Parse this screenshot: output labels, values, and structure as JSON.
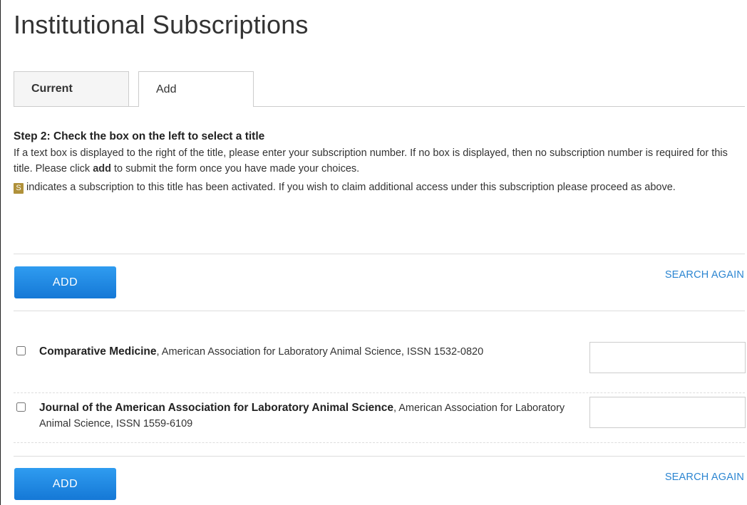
{
  "page": {
    "title": "Institutional Subscriptions"
  },
  "tabs": [
    {
      "label": "Current"
    },
    {
      "label": "Add"
    }
  ],
  "instructions": {
    "heading": "Step 2: Check the box on the left to select a title",
    "line1_a": "If a text box is displayed to the right of the title, please enter your subscription number. If no box is displayed, then no subscription number is required for this title. Please click ",
    "line1_bold": "add",
    "line1_b": " to submit the form once you have made your choices.",
    "badge_letter": "S",
    "line2": "indicates a subscription to this title has been activated. If you wish to claim additional access under this subscription please proceed as above."
  },
  "actions": {
    "add_label": "ADD",
    "search_again_label": "SEARCH AGAIN"
  },
  "titles": [
    {
      "name": "Comparative Medicine",
      "details": ", American Association for Laboratory Animal Science, ISSN 1532-0820",
      "subscription_number": ""
    },
    {
      "name": "Journal of the American Association for Laboratory Animal Science",
      "details": ", American Association for Laboratory Animal Science, ISSN 1559-6109",
      "subscription_number": ""
    }
  ],
  "colors": {
    "button": "#1f88e5",
    "link": "#2b85d1",
    "badge": "#b0913a"
  }
}
